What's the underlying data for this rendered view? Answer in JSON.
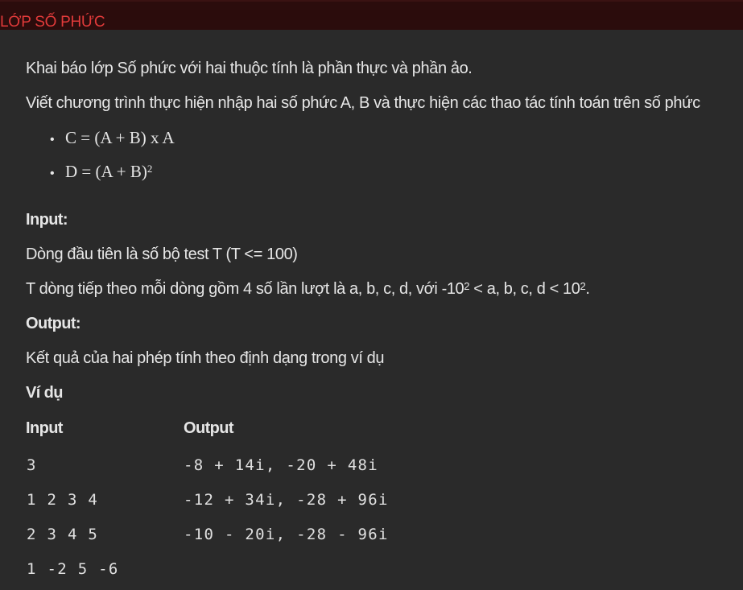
{
  "header": {
    "title": "LỚP SỐ PHỨC"
  },
  "problem": {
    "desc_1": "Khai báo lớp Số phức với hai thuộc tính là phần thực và phần ảo.",
    "desc_2": "Viết chương trình thực hiện nhập hai số phức A, B và thực hiện các thao tác tính toán trên số phức",
    "formula_c": "C = (A + B) x A",
    "formula_d": "D = (A + B)",
    "formula_d_exp": "2",
    "input_heading": "Input:",
    "input_line_1": "Dòng đầu tiên là số bộ test T (T <= 100)",
    "input_line_2_a": "T dòng tiếp theo mỗi dòng gồm 4 số lần lượt là a, b, c, d, với -10",
    "input_line_2_exp1": "2",
    "input_line_2_b": " < a, b, c, d < 10",
    "input_line_2_exp2": "2",
    "input_line_2_end": ".",
    "output_heading": "Output:",
    "output_line": "Kết quả của hai phép tính theo định dạng trong ví dụ",
    "example_heading": "Ví dụ"
  },
  "example": {
    "input_header": "Input",
    "output_header": "Output",
    "input_rows": [
      "3",
      "1 2 3 4",
      "2 3 4 5",
      "1 -2 5 -6"
    ],
    "output_rows": [
      "-8 + 14i, -20 + 48i",
      "-12 + 34i, -28 + 96i",
      "-10 - 20i, -28 - 96i"
    ]
  }
}
